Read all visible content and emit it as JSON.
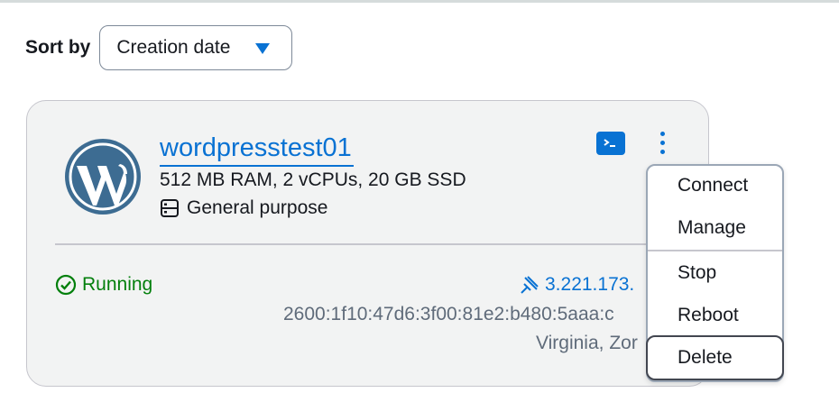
{
  "sort": {
    "label": "Sort by",
    "selected": "Creation date"
  },
  "instance": {
    "name": "wordpresstest01",
    "specs": "512 MB RAM, 2 vCPUs, 20 GB SSD",
    "type": "General purpose",
    "status": "Running",
    "public_ip": "3.221.173.",
    "ipv6": "2600:1f10:47d6:3f00:81e2:b480:5aaa:c",
    "region": "Virginia, Zor",
    "logo_icon": "wordpress-logo",
    "colors": {
      "link": "#0972d3",
      "running": "#037f0c",
      "card_bg": "#f2f3f3"
    }
  },
  "actions_menu": {
    "items": [
      {
        "label": "Connect"
      },
      {
        "label": "Manage"
      },
      {
        "label": "Stop"
      },
      {
        "label": "Reboot"
      },
      {
        "label": "Delete"
      }
    ],
    "focused": "Delete"
  }
}
